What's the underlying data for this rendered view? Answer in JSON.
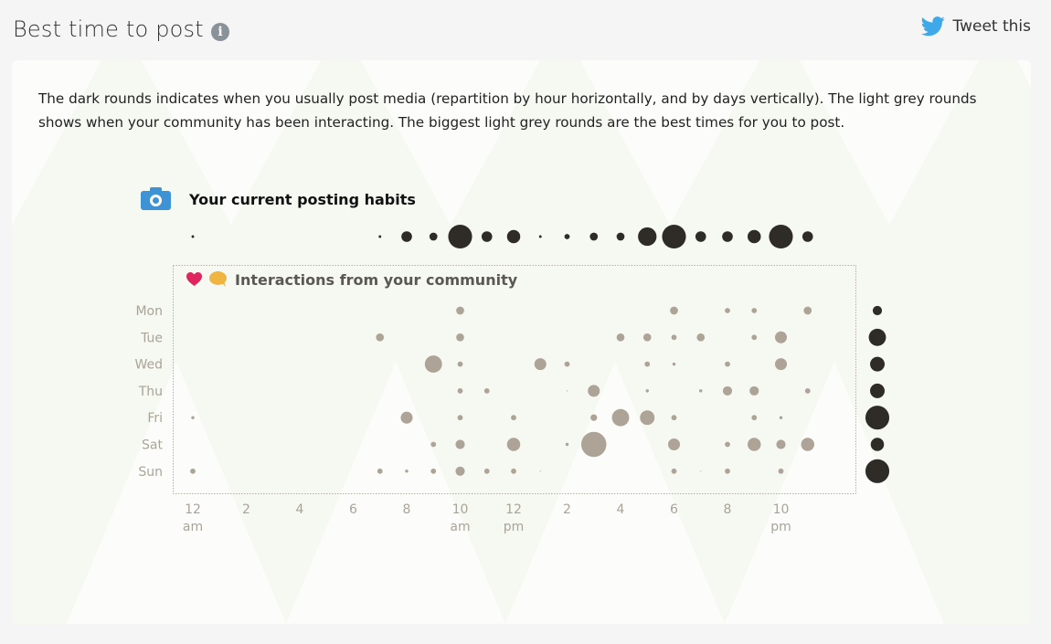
{
  "header": {
    "title": "Best time to post",
    "info_icon": "info-icon",
    "tweet_label": "Tweet this",
    "tweet_icon": "twitter-bird-icon"
  },
  "description": "The dark rounds indicates when you usually post media (repartition by hour horizontally, and by days vertically). The light grey rounds shows when your community has been interacting. The biggest light grey rounds are the best times for you to post.",
  "colors": {
    "posting": "#2f2b26",
    "interaction": "#ada497",
    "camera": "#3d93d4",
    "heart": "#e0245e",
    "bubble": "#f0b440",
    "twitter": "#3ea8e8"
  },
  "chart_data": {
    "type": "scatter",
    "subtype": "punchcard",
    "posting_title": "Your current posting habits",
    "posting_icon": "camera-icon",
    "interactions_title": "Interactions from your community",
    "interactions_icons": [
      "heart-icon",
      "speech-bubble-icon"
    ],
    "days": [
      "Mon",
      "Tue",
      "Wed",
      "Thu",
      "Fri",
      "Sat",
      "Sun"
    ],
    "hour_range": [
      0,
      23
    ],
    "x_ticks": [
      {
        "hour": 0,
        "label": "12",
        "sub": "am"
      },
      {
        "hour": 2,
        "label": "2",
        "sub": ""
      },
      {
        "hour": 4,
        "label": "4",
        "sub": ""
      },
      {
        "hour": 6,
        "label": "6",
        "sub": ""
      },
      {
        "hour": 8,
        "label": "8",
        "sub": ""
      },
      {
        "hour": 10,
        "label": "10",
        "sub": "am"
      },
      {
        "hour": 12,
        "label": "12",
        "sub": "pm"
      },
      {
        "hour": 14,
        "label": "2",
        "sub": ""
      },
      {
        "hour": 16,
        "label": "4",
        "sub": ""
      },
      {
        "hour": 18,
        "label": "6",
        "sub": ""
      },
      {
        "hour": 20,
        "label": "8",
        "sub": ""
      },
      {
        "hour": 22,
        "label": "10",
        "sub": "pm"
      }
    ],
    "size_scale_max": 10,
    "posting_by_hour": [
      {
        "hour": 0,
        "value": 1
      },
      {
        "hour": 7,
        "value": 1
      },
      {
        "hour": 8,
        "value": 4
      },
      {
        "hour": 9,
        "value": 3
      },
      {
        "hour": 10,
        "value": 9
      },
      {
        "hour": 11,
        "value": 4
      },
      {
        "hour": 12,
        "value": 5
      },
      {
        "hour": 13,
        "value": 1
      },
      {
        "hour": 14,
        "value": 2
      },
      {
        "hour": 15,
        "value": 3
      },
      {
        "hour": 16,
        "value": 3
      },
      {
        "hour": 17,
        "value": 7
      },
      {
        "hour": 18,
        "value": 9
      },
      {
        "hour": 19,
        "value": 4
      },
      {
        "hour": 20,
        "value": 4
      },
      {
        "hour": 21,
        "value": 5
      },
      {
        "hour": 22,
        "value": 9
      },
      {
        "hour": 23,
        "value": 4
      }
    ],
    "posting_by_day": [
      {
        "day": "Mon",
        "value": 3.5
      },
      {
        "day": "Tue",
        "value": 6.5
      },
      {
        "day": "Wed",
        "value": 5.5
      },
      {
        "day": "Thu",
        "value": 5.5
      },
      {
        "day": "Fri",
        "value": 9
      },
      {
        "day": "Sat",
        "value": 5
      },
      {
        "day": "Sun",
        "value": 9
      }
    ],
    "interactions": [
      {
        "day": "Mon",
        "hour": 10,
        "value": 3
      },
      {
        "day": "Mon",
        "hour": 18,
        "value": 3
      },
      {
        "day": "Mon",
        "hour": 20,
        "value": 2
      },
      {
        "day": "Mon",
        "hour": 21,
        "value": 2
      },
      {
        "day": "Mon",
        "hour": 23,
        "value": 3
      },
      {
        "day": "Tue",
        "hour": 7,
        "value": 3
      },
      {
        "day": "Tue",
        "hour": 10,
        "value": 3
      },
      {
        "day": "Tue",
        "hour": 16,
        "value": 3
      },
      {
        "day": "Tue",
        "hour": 17,
        "value": 3
      },
      {
        "day": "Tue",
        "hour": 18,
        "value": 2
      },
      {
        "day": "Tue",
        "hour": 19,
        "value": 3
      },
      {
        "day": "Tue",
        "hour": 21,
        "value": 2
      },
      {
        "day": "Tue",
        "hour": 22,
        "value": 4.5
      },
      {
        "day": "Wed",
        "hour": 9,
        "value": 6.5
      },
      {
        "day": "Wed",
        "hour": 10,
        "value": 2
      },
      {
        "day": "Wed",
        "hour": 13,
        "value": 4.5
      },
      {
        "day": "Wed",
        "hour": 14,
        "value": 2
      },
      {
        "day": "Wed",
        "hour": 17,
        "value": 2
      },
      {
        "day": "Wed",
        "hour": 18,
        "value": 1.2
      },
      {
        "day": "Wed",
        "hour": 20,
        "value": 2
      },
      {
        "day": "Wed",
        "hour": 22,
        "value": 4.5
      },
      {
        "day": "Thu",
        "hour": 10,
        "value": 2
      },
      {
        "day": "Thu",
        "hour": 11,
        "value": 2
      },
      {
        "day": "Thu",
        "hour": 14,
        "value": 0.3
      },
      {
        "day": "Thu",
        "hour": 15,
        "value": 4.5
      },
      {
        "day": "Thu",
        "hour": 17,
        "value": 1.2
      },
      {
        "day": "Thu",
        "hour": 19,
        "value": 1.2
      },
      {
        "day": "Thu",
        "hour": 20,
        "value": 3.5
      },
      {
        "day": "Thu",
        "hour": 21,
        "value": 3.5
      },
      {
        "day": "Thu",
        "hour": 23,
        "value": 2
      },
      {
        "day": "Fri",
        "hour": 0,
        "value": 1.2
      },
      {
        "day": "Fri",
        "hour": 8,
        "value": 4.5
      },
      {
        "day": "Fri",
        "hour": 10,
        "value": 2
      },
      {
        "day": "Fri",
        "hour": 12,
        "value": 2
      },
      {
        "day": "Fri",
        "hour": 15,
        "value": 2.5
      },
      {
        "day": "Fri",
        "hour": 16,
        "value": 6.5
      },
      {
        "day": "Fri",
        "hour": 17,
        "value": 5.5
      },
      {
        "day": "Fri",
        "hour": 18,
        "value": 2
      },
      {
        "day": "Fri",
        "hour": 21,
        "value": 2
      },
      {
        "day": "Fri",
        "hour": 22,
        "value": 1.2
      },
      {
        "day": "Sat",
        "hour": 9,
        "value": 2
      },
      {
        "day": "Sat",
        "hour": 10,
        "value": 3.5
      },
      {
        "day": "Sat",
        "hour": 12,
        "value": 5
      },
      {
        "day": "Sat",
        "hour": 14,
        "value": 1.2
      },
      {
        "day": "Sat",
        "hour": 15,
        "value": 9.5
      },
      {
        "day": "Sat",
        "hour": 18,
        "value": 4.5
      },
      {
        "day": "Sat",
        "hour": 20,
        "value": 2
      },
      {
        "day": "Sat",
        "hour": 21,
        "value": 5
      },
      {
        "day": "Sat",
        "hour": 22,
        "value": 3.5
      },
      {
        "day": "Sat",
        "hour": 23,
        "value": 5
      },
      {
        "day": "Sun",
        "hour": 0,
        "value": 2
      },
      {
        "day": "Sun",
        "hour": 7,
        "value": 2
      },
      {
        "day": "Sun",
        "hour": 8,
        "value": 1.2
      },
      {
        "day": "Sun",
        "hour": 9,
        "value": 2
      },
      {
        "day": "Sun",
        "hour": 10,
        "value": 3.5
      },
      {
        "day": "Sun",
        "hour": 11,
        "value": 2
      },
      {
        "day": "Sun",
        "hour": 12,
        "value": 2
      },
      {
        "day": "Sun",
        "hour": 13,
        "value": 0.3
      },
      {
        "day": "Sun",
        "hour": 18,
        "value": 2
      },
      {
        "day": "Sun",
        "hour": 19,
        "value": 0.3
      },
      {
        "day": "Sun",
        "hour": 20,
        "value": 2
      },
      {
        "day": "Sun",
        "hour": 22,
        "value": 2
      }
    ]
  }
}
